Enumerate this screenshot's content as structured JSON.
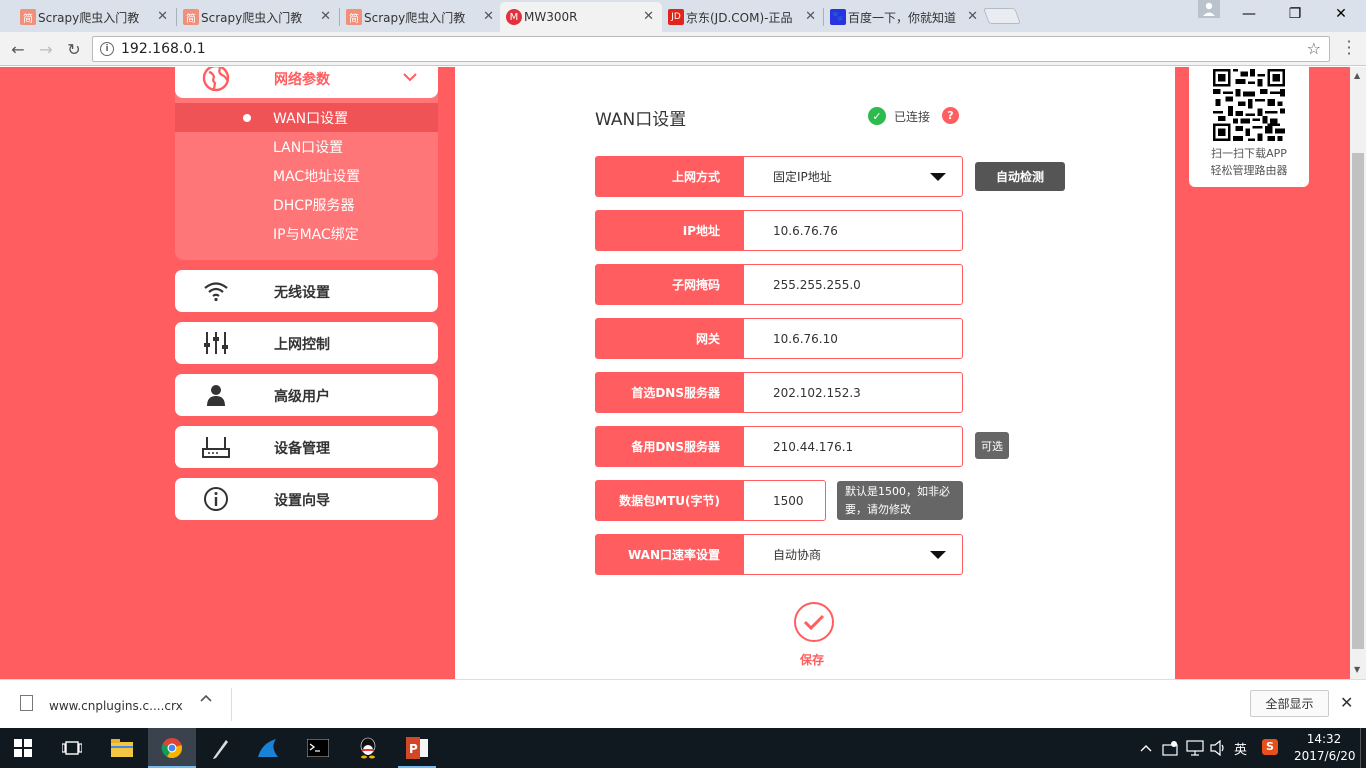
{
  "browser": {
    "tabs": [
      {
        "title": "Scrapy爬虫入门教",
        "favicon": "简",
        "favicon_color": "#f08f7a",
        "active": false
      },
      {
        "title": "Scrapy爬虫入门教",
        "favicon": "简",
        "favicon_color": "#f08f7a",
        "active": false
      },
      {
        "title": "Scrapy爬虫入门教",
        "favicon": "简",
        "favicon_color": "#f08f7a",
        "active": false
      },
      {
        "title": "MW300R",
        "favicon": "M",
        "favicon_color": "#e0323c",
        "active": true
      },
      {
        "title": "京东(JD.COM)-正品",
        "favicon": "JD",
        "favicon_color": "#e1251b",
        "active": false
      },
      {
        "title": "百度一下，你就知道",
        "favicon": "🐾",
        "favicon_color": "#2932e1",
        "active": false
      }
    ],
    "tab_close": "✕",
    "url": "192.168.0.1",
    "window_controls": {
      "minimize": "—",
      "maximize": "❐",
      "close": "✕"
    },
    "nav_icons": {
      "back": "←",
      "forward": "→",
      "reload": "↻",
      "star": "☆"
    }
  },
  "sidebar": {
    "network": {
      "label": "网络参数",
      "expanded": true,
      "subitems": [
        {
          "label": "WAN口设置",
          "active": true
        },
        {
          "label": "LAN口设置",
          "active": false
        },
        {
          "label": "MAC地址设置",
          "active": false
        },
        {
          "label": "DHCP服务器",
          "active": false
        },
        {
          "label": "IP与MAC绑定",
          "active": false
        }
      ]
    },
    "menu": [
      {
        "label": "无线设置",
        "icon": "wifi-icon"
      },
      {
        "label": "上网控制",
        "icon": "sliders-icon"
      },
      {
        "label": "高级用户",
        "icon": "user-icon"
      },
      {
        "label": "设备管理",
        "icon": "router-icon"
      },
      {
        "label": "设置向导",
        "icon": "info-icon"
      }
    ]
  },
  "main": {
    "title": "WAN口设置",
    "status": "已连接",
    "status_color": "#2dbb4e",
    "help": "?",
    "detect_button": "自动检测",
    "optional_badge": "可选",
    "mtu_tip": "默认是1500，如非必要，请勿修改",
    "save_label": "保存",
    "fields": [
      {
        "label": "上网方式",
        "value": "固定IP地址",
        "type": "select"
      },
      {
        "label": "IP地址",
        "value": "10.6.76.76",
        "type": "input"
      },
      {
        "label": "子网掩码",
        "value": "255.255.255.0",
        "type": "input"
      },
      {
        "label": "网关",
        "value": "10.6.76.10",
        "type": "input"
      },
      {
        "label": "首选DNS服务器",
        "value": "202.102.152.3",
        "type": "input"
      },
      {
        "label": "备用DNS服务器",
        "value": "210.44.176.1",
        "type": "input"
      },
      {
        "label": "数据包MTU(字节)",
        "value": "1500",
        "type": "input"
      },
      {
        "label": "WAN口速率设置",
        "value": "自动协商",
        "type": "select"
      }
    ]
  },
  "qr_card": {
    "line1": "扫一扫下载APP",
    "line2": "轻松管理路由器"
  },
  "download_bar": {
    "file": "www.cnplugins.c....crx",
    "show_all": "全部显示"
  },
  "taskbar": {
    "time": "14:32",
    "date": "2017/6/20",
    "ime": "英"
  },
  "colors": {
    "brand": "#ff5d5f",
    "menu_sub_bg": "#ff7678",
    "active_sub": "#f05355"
  }
}
